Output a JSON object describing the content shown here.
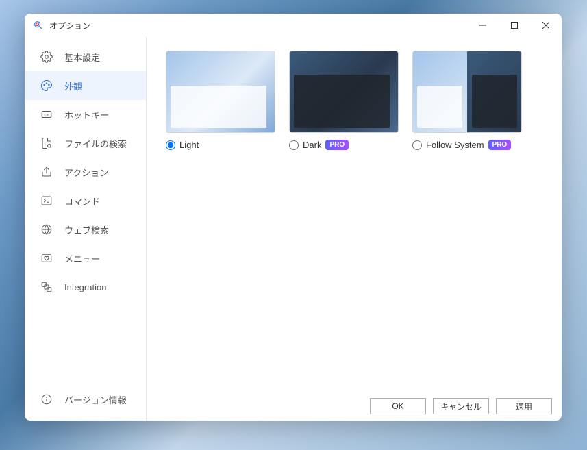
{
  "window": {
    "title": "オプション"
  },
  "sidebar": {
    "items": [
      {
        "label": "基本設定"
      },
      {
        "label": "外観"
      },
      {
        "label": "ホットキー"
      },
      {
        "label": "ファイルの検索"
      },
      {
        "label": "アクション"
      },
      {
        "label": "コマンド"
      },
      {
        "label": "ウェブ検索"
      },
      {
        "label": "メニュー"
      },
      {
        "label": "Integration"
      }
    ],
    "footer": {
      "label": "バージョン情報"
    }
  },
  "themes": {
    "light": {
      "label": "Light"
    },
    "dark": {
      "label": "Dark",
      "badge": "PRO"
    },
    "follow": {
      "label": "Follow System",
      "badge": "PRO"
    }
  },
  "buttons": {
    "ok": "OK",
    "cancel": "キャンセル",
    "apply": "適用"
  }
}
